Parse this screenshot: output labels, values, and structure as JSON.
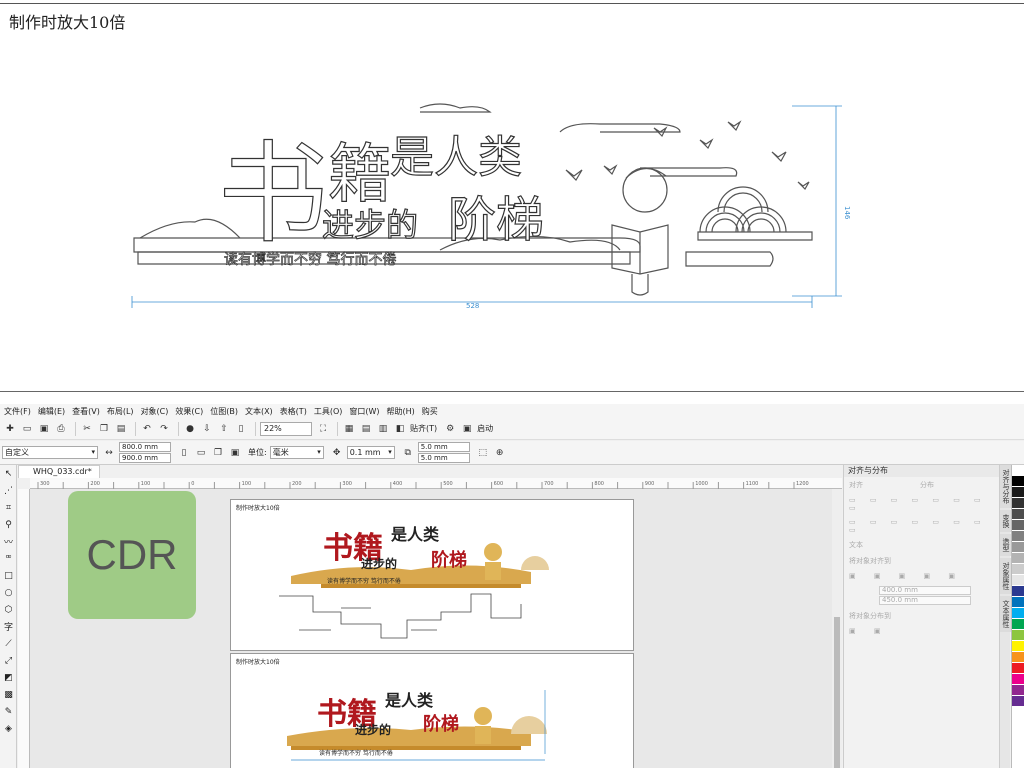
{
  "top": {
    "title": "制作时放大10倍",
    "artwork": {
      "headline_big": "书",
      "headline_2": "籍",
      "headline_3": "是人类",
      "headline_4": "进步的",
      "headline_5": "阶梯",
      "slogan": "读有博学而不穷 笃行而不倦",
      "dim_width": "528",
      "dim_height": "146"
    }
  },
  "menubar": [
    "文件(F)",
    "编辑(E)",
    "查看(V)",
    "布局(L)",
    "对象(C)",
    "效果(C)",
    "位图(B)",
    "文本(X)",
    "表格(T)",
    "工具(O)",
    "窗口(W)",
    "帮助(H)",
    "购买"
  ],
  "toolbar": {
    "zoom": "22%",
    "snap_label": "贴齐(T)",
    "launch_label": "启动"
  },
  "propbar": {
    "preset": "自定义",
    "width": "800.0 mm",
    "height": "900.0 mm",
    "unit_label": "单位:",
    "unit": "毫米",
    "nudge": "0.1 mm",
    "dup_x": "5.0 mm",
    "dup_y": "5.0 mm"
  },
  "document": {
    "tab": "WHQ_033.cdr*"
  },
  "ruler_ticks": [
    "300",
    "250",
    "200",
    "150",
    "100",
    "50",
    "0",
    "50",
    "100",
    "150",
    "200",
    "250",
    "300",
    "350",
    "400",
    "450",
    "500",
    "550",
    "600",
    "650",
    "700",
    "750",
    "800",
    "850",
    "900",
    "950",
    "1000",
    "1050",
    "1100",
    "1150",
    "1200"
  ],
  "canvas": {
    "badge": "CDR",
    "page1_label": "制作时放大10倍",
    "page2_label": "制作时放大10倍",
    "art_head_1": "书籍",
    "art_head_2": "是人类",
    "art_head_3": "进步的",
    "art_head_4": "阶梯",
    "art_slogan": "读有博学而不穷 笃行而不倦"
  },
  "panel": {
    "title": "对齐与分布",
    "align": "对齐",
    "distribute": "分布",
    "text": "文本",
    "align_to": "将对象对齐到",
    "w": "400.0 mm",
    "h": "450.0 mm",
    "dist_to": "将对象分布到"
  },
  "sidetabs": [
    "对齐与分布",
    "变换",
    "造型",
    "对象属性",
    "文本属性"
  ],
  "palette": [
    "#ffffff",
    "#000000",
    "#1a1a1a",
    "#333333",
    "#4d4d4d",
    "#666666",
    "#808080",
    "#999999",
    "#b3b3b3",
    "#cccccc",
    "#e6e6e6",
    "#2b3990",
    "#0072bc",
    "#00aeef",
    "#00a651",
    "#8dc63f",
    "#fff200",
    "#f7941d",
    "#ed1c24",
    "#ec008c",
    "#92278f",
    "#662d91"
  ]
}
